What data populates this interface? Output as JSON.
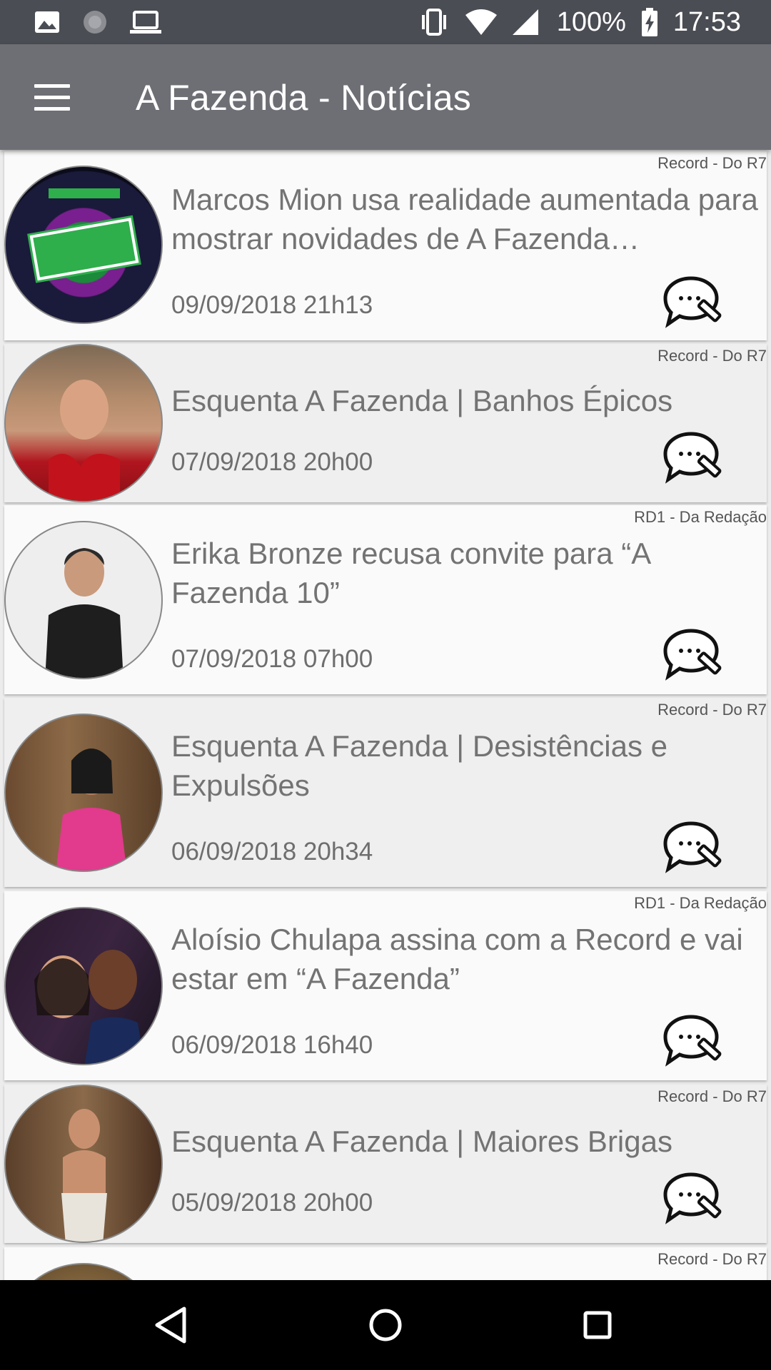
{
  "status_bar": {
    "battery": "100%",
    "time": "17:53",
    "icons": [
      "image-icon",
      "sync-icon",
      "laptop-icon",
      "vibrate-icon",
      "wifi-icon",
      "signal-icon",
      "battery-charging-icon"
    ]
  },
  "app_bar": {
    "title": "A Fazenda - Notícias",
    "menu_icon": "hamburger-menu-icon"
  },
  "news": [
    {
      "source": "Record - Do R7",
      "title": "Marcos Mion usa realidade aumentada para mostrar novidades de A Fazenda…",
      "date": "09/09/2018 21h13"
    },
    {
      "source": "Record - Do R7",
      "title": "Esquenta A Fazenda | Banhos Épicos",
      "date": "07/09/2018 20h00"
    },
    {
      "source": "RD1 - Da Redação",
      "title": "Erika Bronze recusa convite para “A Fazenda 10”",
      "date": "07/09/2018 07h00"
    },
    {
      "source": "Record - Do R7",
      "title": "Esquenta A Fazenda | Desistências e Expulsões",
      "date": "06/09/2018 20h34"
    },
    {
      "source": "RD1 - Da Redação",
      "title": "Aloísio Chulapa assina com a Record e vai estar em “A Fazenda”",
      "date": "06/09/2018 16h40"
    },
    {
      "source": "Record - Do R7",
      "title": "Esquenta A Fazenda | Maiores Brigas",
      "date": "05/09/2018 20h00"
    },
    {
      "source": "Record - Do R7",
      "title": "",
      "date": ""
    }
  ],
  "nav_bar": {
    "icons": [
      "back-icon",
      "home-icon",
      "recents-icon"
    ]
  },
  "colors": {
    "status_bar": "#4b4d55",
    "app_bar": "#6e6f75",
    "card_white": "#fafafa",
    "card_grey": "#efefef",
    "text": "#737373"
  }
}
